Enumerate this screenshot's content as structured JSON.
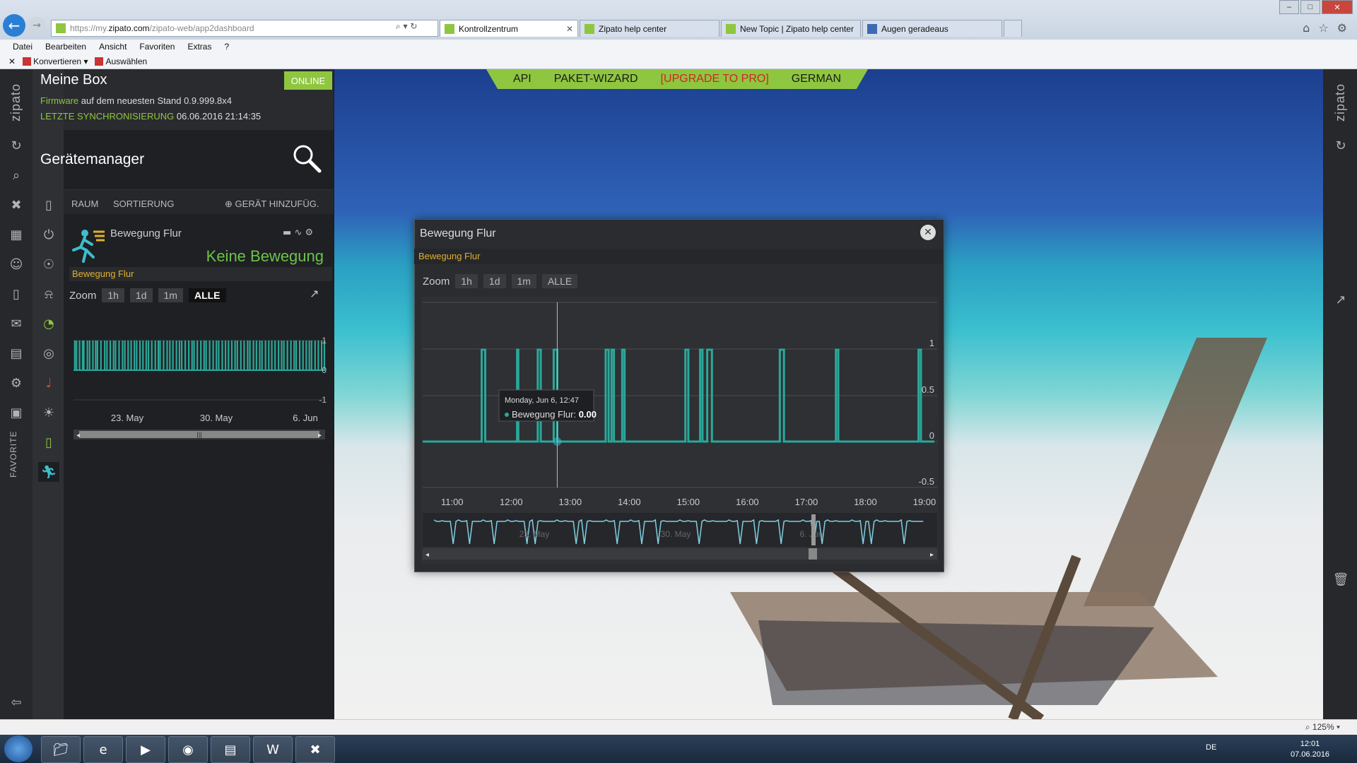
{
  "browser": {
    "url_prefix": "https://my.",
    "url_host": "zipato.com",
    "url_path": "/zipato-web/app2dashboard",
    "tabs": [
      {
        "label": "Kontrollzentrum",
        "active": true,
        "close": "✕"
      },
      {
        "label": "Zipato help center"
      },
      {
        "label": "New Topic | Zipato help center"
      },
      {
        "label": "Augen geradeaus"
      }
    ],
    "menu": [
      "Datei",
      "Bearbeiten",
      "Ansicht",
      "Favoriten",
      "Extras",
      "?"
    ],
    "cmd_convert": "Konvertieren",
    "cmd_select": "Auswählen"
  },
  "rail": {
    "brand": "zipato",
    "favorites": "FAVORITE"
  },
  "box": {
    "title": "Meine Box",
    "status": "ONLINE",
    "firmware_label": "Firmware",
    "firmware_text": "auf dem neuesten Stand 0.9.999.8x4",
    "sync_label": "LETZTE SYNCHRONISIERUNG",
    "sync_value": "06.06.2016 21:14:35"
  },
  "devmgr": {
    "title": "Gerätemanager",
    "nav_room": "RAUM",
    "nav_sort": "SORTIERUNG",
    "nav_add": "GERÄT HINZUFÜG."
  },
  "device": {
    "name": "Bewegung Flur",
    "state": "Keine Bewegung",
    "attr_label": "Bewegung Flur"
  },
  "zoom": {
    "label": "Zoom",
    "options": [
      "1h",
      "1d",
      "1m",
      "ALLE"
    ],
    "active": "ALLE"
  },
  "topmenu": {
    "api": "API",
    "wizard": "PAKET-WIZARD",
    "upgrade": "[UPGRADE TO PRO]",
    "lang": "GERMAN"
  },
  "modal": {
    "title": "Bewegung Flur",
    "attr_label": "Bewegung Flur",
    "tooltip_date": "Monday, Jun 6, 12:47",
    "tooltip_series": "Bewegung Flur:",
    "tooltip_value": "0.00"
  },
  "chart_data": [
    {
      "type": "line",
      "name": "overview",
      "x_ticks": [
        "23. May",
        "30. May",
        "6. Jun"
      ],
      "y_ticks": [
        1,
        0,
        -1
      ],
      "ylim": [
        -1,
        1
      ],
      "series": [
        {
          "name": "Bewegung Flur",
          "values_note": "step"
        }
      ],
      "events": [
        0.2,
        0.9,
        2.1,
        3.3,
        3.8,
        5.2,
        6.1,
        7.4,
        8.5,
        9.2,
        10.6,
        12.1,
        13.0,
        14.3,
        15.6,
        16.4,
        17.8,
        19.2,
        20.1,
        21.4,
        22.6,
        23.9,
        24.8,
        26.1,
        27.3,
        28.6,
        29.5,
        30.8,
        32.2,
        33.4,
        34.1,
        35.5,
        36.9,
        38.0,
        39.2,
        40.6,
        41.8,
        42.7,
        44.1,
        45.5,
        46.8,
        47.6,
        48.9,
        50.3,
        51.6,
        52.4,
        53.8,
        55.2,
        56.5,
        57.4,
        58.8,
        60.1,
        61.3,
        62.6,
        63.9,
        64.8,
        66.2,
        67.5,
        68.9,
        69.8,
        71.2,
        72.4,
        73.7,
        74.6,
        76.0,
        77.3,
        78.5,
        79.8,
        81.2,
        82.4,
        83.3,
        84.7,
        86.1,
        87.4,
        88.2,
        89.6,
        90.9,
        92.2,
        93.4,
        94.3,
        95.7,
        97.0,
        98.3,
        99.4
      ]
    },
    {
      "type": "line",
      "name": "detail",
      "x_ticks": [
        "11:00",
        "12:00",
        "13:00",
        "14:00",
        "15:00",
        "16:00",
        "17:00",
        "18:00",
        "19:00"
      ],
      "y_ticks": [
        1,
        0.5,
        0,
        -0.5
      ],
      "ylim": [
        -0.5,
        1
      ],
      "pulses": [
        [
          11.5,
          11.56
        ],
        [
          12.1,
          12.12
        ],
        [
          12.45,
          12.5
        ],
        [
          12.72,
          12.78
        ],
        [
          13.6,
          13.65
        ],
        [
          13.7,
          13.74
        ],
        [
          13.88,
          13.92
        ],
        [
          14.95,
          15.0
        ],
        [
          15.2,
          15.24
        ],
        [
          15.32,
          15.4
        ],
        [
          16.55,
          16.62
        ],
        [
          17.5,
          17.54
        ],
        [
          18.9,
          18.94
        ]
      ],
      "tooltip_x": 12.78,
      "navigator_labels": [
        "23. May",
        "30. May",
        "6. Jun"
      ]
    }
  ]
}
